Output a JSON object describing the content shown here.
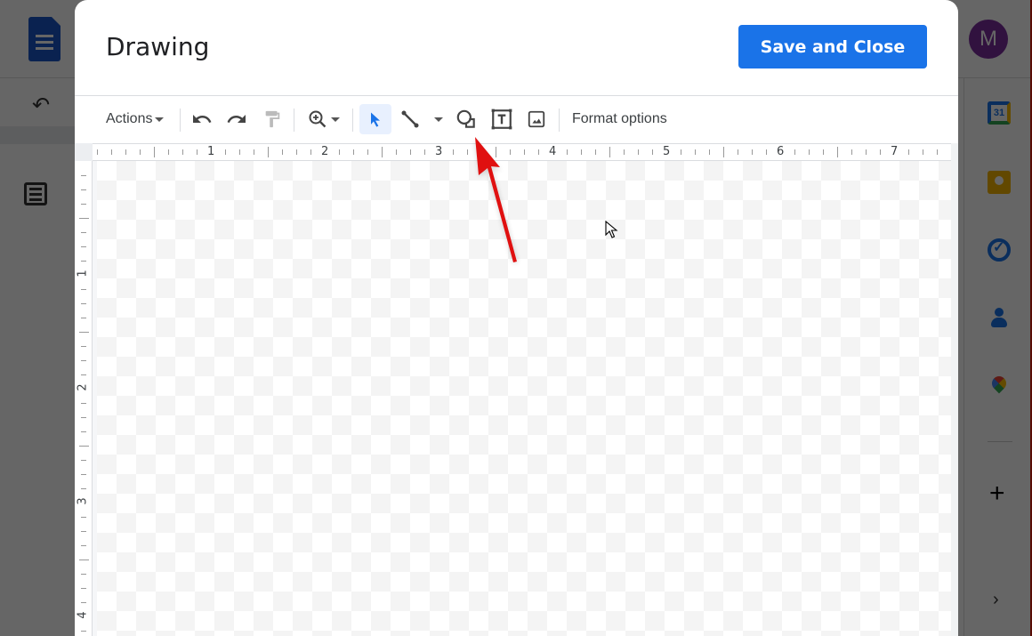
{
  "background_app": {
    "avatar_initial": "M",
    "side_panel": [
      "calendar-icon",
      "keep-icon",
      "tasks-icon",
      "contacts-icon",
      "maps-icon"
    ],
    "calendar_day": "31",
    "add_label": "+",
    "expand_label": "›"
  },
  "dialog": {
    "title": "Drawing",
    "save_button": "Save and Close"
  },
  "toolbar": {
    "actions_label": "Actions",
    "format_options_label": "Format options",
    "icons": [
      "undo-icon",
      "redo-icon",
      "paint-format-icon",
      "zoom-icon",
      "select-icon",
      "line-icon",
      "shape-icon",
      "text-box-icon",
      "image-icon"
    ],
    "selected_tool": "select",
    "accent_color": "#1a73e8"
  },
  "rulers": {
    "horizontal_labels": [
      "1",
      "2",
      "3",
      "4",
      "5",
      "6",
      "7"
    ],
    "vertical_labels": [
      "1",
      "2",
      "3",
      "4"
    ]
  },
  "annotation": {
    "arrow_color": "#e01010",
    "points_to": "shape-icon"
  }
}
